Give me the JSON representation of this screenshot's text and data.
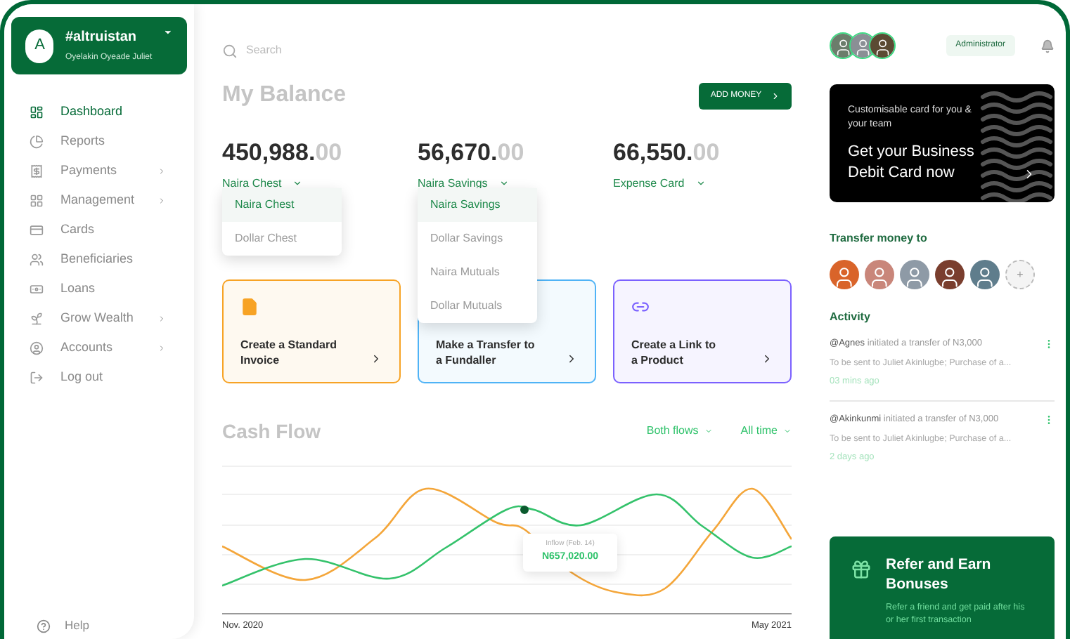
{
  "account": {
    "initial": "A",
    "name": "#altruistan",
    "user": "Oyelakin Oyeade Juliet"
  },
  "sidebar": {
    "items": [
      {
        "label": "Dashboard",
        "selected": true,
        "submenu": false
      },
      {
        "label": "Reports",
        "selected": false,
        "submenu": false
      },
      {
        "label": "Payments",
        "selected": false,
        "submenu": true
      },
      {
        "label": "Management",
        "selected": false,
        "submenu": true
      },
      {
        "label": "Cards",
        "selected": false,
        "submenu": false
      },
      {
        "label": "Beneficiaries",
        "selected": false,
        "submenu": false
      },
      {
        "label": "Loans",
        "selected": false,
        "submenu": false
      },
      {
        "label": "Grow Wealth",
        "selected": false,
        "submenu": true
      },
      {
        "label": "Accounts",
        "selected": false,
        "submenu": true
      },
      {
        "label": "Log out",
        "selected": false,
        "submenu": false
      }
    ],
    "help": "Help"
  },
  "search": {
    "placeholder": "Search"
  },
  "balance": {
    "title": "My Balance",
    "add_button": "ADD MONEY",
    "accounts": [
      {
        "whole": "450,988.",
        "cents": "00",
        "account": "Naira Chest",
        "expanded": true,
        "options": [
          {
            "label": "Naira Chest",
            "selected": true
          },
          {
            "label": "Dollar Chest",
            "selected": false
          }
        ]
      },
      {
        "whole": "56,670.",
        "cents": "00",
        "account": "Naira Savings",
        "expanded": true,
        "options": [
          {
            "label": "Naira Savings",
            "selected": true
          },
          {
            "label": "Dollar Savings",
            "selected": false
          },
          {
            "label": "Naira Mutuals",
            "selected": false
          },
          {
            "label": "Dollar Mutuals",
            "selected": false
          }
        ]
      },
      {
        "whole": "66,550.",
        "cents": "00",
        "account": "Expense Card",
        "expanded": false
      }
    ]
  },
  "actions": [
    {
      "line1": "Create a Standard",
      "line2": "Invoice",
      "color": "#f7a325",
      "kind": "invoice"
    },
    {
      "line1": "Make a Transfer to",
      "line2": "a Fundaller",
      "color": "#4fb3f6",
      "kind": "transfer"
    },
    {
      "line1": "Create a Link to",
      "line2": "a Product",
      "color": "#7b61ff",
      "kind": "link"
    }
  ],
  "cash_flow": {
    "title": "Cash Flow",
    "filters": [
      "Both flows",
      "All time"
    ],
    "tooltip_label": "Inflow (Feb. 14)",
    "tooltip_value": "N657,020.00",
    "x_start": "Nov. 2020",
    "x_end": "May 2021"
  },
  "header": {
    "role": "Administrator"
  },
  "promo": {
    "subtitle": "Customisable card for you & your team",
    "title": "Get your Business Debit Card now"
  },
  "transfer": {
    "title": "Transfer money to",
    "add": "+"
  },
  "activity": {
    "title": "Activity",
    "items": [
      {
        "user": "@Agnes",
        "text": "initiated a transfer of N3,000",
        "detail": "To be sent to Juliet Akinlugbe; Purchase of a...",
        "time": "03 mins ago"
      },
      {
        "user": "@Akinkunmi",
        "text": "initiated a transfer of N3,000",
        "detail": "To be sent to Juliet Akinlugbe; Purchase of a...",
        "time": "2 days ago"
      }
    ]
  },
  "refer": {
    "title": "Refer and Earn Bonuses",
    "text": "Refer a friend and get paid after his or her first transaction"
  }
}
